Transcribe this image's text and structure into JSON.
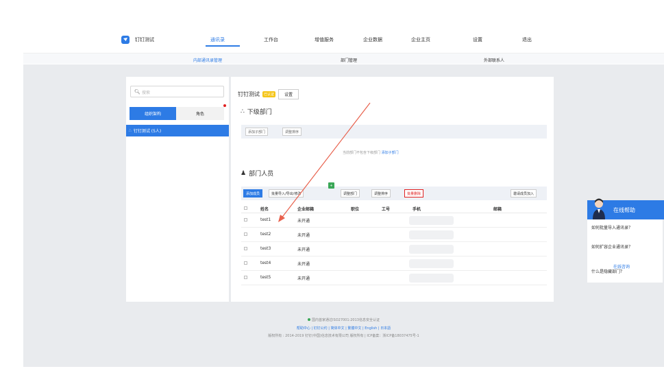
{
  "app": {
    "logo_text": "钉钉测试"
  },
  "topnav": {
    "items": [
      {
        "label": "通讯录",
        "active": true
      },
      {
        "label": "工作台",
        "active": false
      },
      {
        "label": "增值服务",
        "active": false
      },
      {
        "label": "企业数据",
        "active": false
      },
      {
        "label": "企业主页",
        "active": false
      },
      {
        "label": "设置",
        "active": false
      },
      {
        "label": "退出",
        "active": false
      }
    ]
  },
  "subnav": {
    "items": [
      {
        "label": "内部通讯录管理",
        "active": true
      },
      {
        "label": "部门管理",
        "active": false
      },
      {
        "label": "外部联系人",
        "active": false
      }
    ]
  },
  "sidebar": {
    "search_placeholder": "搜索",
    "tab_org": "组织架构",
    "tab_role": "角色",
    "tree_selected": "钉钉测试 (5人)"
  },
  "main": {
    "dept_name": "钉钉测试",
    "dept_badge": "已认证",
    "settings_btn": "设置",
    "subdept_heading": "下级部门",
    "add_subdept_btn": "添加子部门",
    "adjust_order_btn": "调整排序",
    "empty_text": "当前部门不包含下级部门",
    "empty_link": "添加子部门",
    "members_heading": "部门人员",
    "member_toolbar": {
      "add_member": "添加成员",
      "batch_import": "批量导入/导出/修改",
      "import_badge": "+",
      "adjust_dept": "调整部门",
      "adjust_order": "调整排序",
      "batch_delete": "批量删除",
      "invite": "邀请成员加入"
    },
    "columns": [
      "姓名",
      "企业邮箱",
      "职位",
      "工号",
      "手机",
      "邮箱"
    ],
    "rows": [
      {
        "name": "test1",
        "email": "未开通"
      },
      {
        "name": "test2",
        "email": "未开通"
      },
      {
        "name": "test3",
        "email": "未开通"
      },
      {
        "name": "test4",
        "email": "未开通"
      },
      {
        "name": "test5",
        "email": "未开通"
      }
    ]
  },
  "footer": {
    "cert_text": "国内首家通过ISO27001:2013信息安全认证",
    "links": "帮助中心 | 钉钉公约 | 简体中文 | 繁體中文 | English | 日本語",
    "copyright": "版权所有 : 2014-2019 钉钉(中国)信息技术有限公司 版权所有 | ICP备案：浙ICP备18037475号-1"
  },
  "help_widget": {
    "title": "在线帮助",
    "q1": "如何批量导入通讯录？",
    "q2": "如何扩容企业通讯录？",
    "q3": "什么是隐藏部门？",
    "link": "在线咨询"
  },
  "colors": {
    "accent": "#2d7be5",
    "danger": "#e02020",
    "badge": "#f5c518",
    "annotation": "#e8604c"
  }
}
